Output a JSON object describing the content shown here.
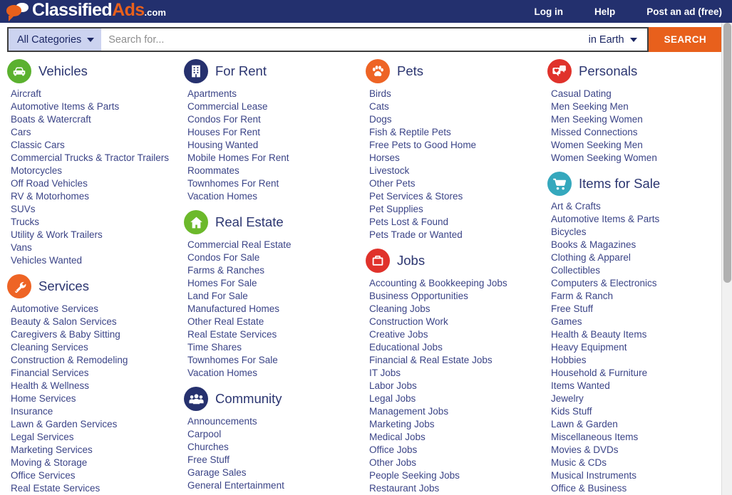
{
  "header": {
    "logo": {
      "part1": "Classified",
      "part2": "Ads",
      "part3": ".com",
      "icon": "speech-bubbles-icon"
    },
    "nav": [
      {
        "label": "Log in",
        "name": "login-link"
      },
      {
        "label": "Help",
        "name": "help-link"
      },
      {
        "label": "Post an ad (free)",
        "name": "post-ad-link"
      }
    ]
  },
  "search": {
    "category_selected": "All Categories",
    "placeholder": "Search for...",
    "value": "",
    "location_selected": "in Earth",
    "button_label": "SEARCH",
    "caret_icon": "chevron-down-icon"
  },
  "colors": {
    "navy": "#23306e",
    "orange": "#e8601c",
    "link": "#3b4487",
    "title": "#2b3570",
    "green": "#5bb12f",
    "darkblue": "#26316e",
    "red": "#e0322b",
    "teal": "#35a8bd",
    "category_chip": "#ccd3f0"
  },
  "columns": [
    {
      "groups": [
        {
          "title": "Vehicles",
          "icon": "car-icon",
          "color": "#5bb12f",
          "links": [
            "Aircraft",
            "Automotive Items & Parts",
            "Boats & Watercraft",
            "Cars",
            "Classic Cars",
            "Commercial Trucks & Tractor Trailers",
            "Motorcycles",
            "Off Road Vehicles",
            "RV & Motorhomes",
            "SUVs",
            "Trucks",
            "Utility & Work Trailers",
            "Vans",
            "Vehicles Wanted"
          ]
        },
        {
          "title": "Services",
          "icon": "wrench-icon",
          "color": "#ee6425",
          "links": [
            "Automotive Services",
            "Beauty & Salon Services",
            "Caregivers & Baby Sitting",
            "Cleaning Services",
            "Construction & Remodeling",
            "Financial Services",
            "Health & Wellness",
            "Home Services",
            "Insurance",
            "Lawn & Garden Services",
            "Legal Services",
            "Marketing Services",
            "Moving & Storage",
            "Office Services",
            "Real Estate Services"
          ]
        }
      ]
    },
    {
      "groups": [
        {
          "title": "For Rent",
          "icon": "apartment-building-icon",
          "color": "#26316e",
          "links": [
            "Apartments",
            "Commercial Lease",
            "Condos For Rent",
            "Houses For Rent",
            "Housing Wanted",
            "Mobile Homes For Rent",
            "Roommates",
            "Townhomes For Rent",
            "Vacation Homes"
          ]
        },
        {
          "title": "Real Estate",
          "icon": "house-icon",
          "color": "#6cb92b",
          "links": [
            "Commercial Real Estate",
            "Condos For Sale",
            "Farms & Ranches",
            "Homes For Sale",
            "Land For Sale",
            "Manufactured Homes",
            "Other Real Estate",
            "Real Estate Services",
            "Time Shares",
            "Townhomes For Sale",
            "Vacation Homes"
          ]
        },
        {
          "title": "Community",
          "icon": "people-group-icon",
          "color": "#26316e",
          "links": [
            "Announcements",
            "Carpool",
            "Churches",
            "Free Stuff",
            "Garage Sales",
            "General Entertainment"
          ]
        }
      ]
    },
    {
      "groups": [
        {
          "title": "Pets",
          "icon": "paw-print-icon",
          "color": "#ee6425",
          "links": [
            "Birds",
            "Cats",
            "Dogs",
            "Fish & Reptile Pets",
            "Free Pets to Good Home",
            "Horses",
            "Livestock",
            "Other Pets",
            "Pet Services & Stores",
            "Pet Supplies",
            "Pets Lost & Found",
            "Pets Trade or Wanted"
          ]
        },
        {
          "title": "Jobs",
          "icon": "briefcase-icon",
          "color": "#e0322b",
          "links": [
            "Accounting & Bookkeeping Jobs",
            "Business Opportunities",
            "Cleaning Jobs",
            "Construction Work",
            "Creative Jobs",
            "Educational Jobs",
            "Financial & Real Estate Jobs",
            "IT Jobs",
            "Labor Jobs",
            "Legal Jobs",
            "Management Jobs",
            "Marketing Jobs",
            "Medical Jobs",
            "Office Jobs",
            "Other Jobs",
            "People Seeking Jobs",
            "Restaurant Jobs"
          ]
        }
      ]
    },
    {
      "groups": [
        {
          "title": "Personals",
          "icon": "heart-chat-icon",
          "color": "#e0322b",
          "links": [
            "Casual Dating",
            "Men Seeking Men",
            "Men Seeking Women",
            "Missed Connections",
            "Women Seeking Men",
            "Women Seeking Women"
          ]
        },
        {
          "title": "Items for Sale",
          "icon": "shopping-cart-icon",
          "color": "#35a8bd",
          "links": [
            "Art & Crafts",
            "Automotive Items & Parts",
            "Bicycles",
            "Books & Magazines",
            "Clothing & Apparel",
            "Collectibles",
            "Computers & Electronics",
            "Farm & Ranch",
            "Free Stuff",
            "Games",
            "Health & Beauty Items",
            "Heavy Equipment",
            "Hobbies",
            "Household & Furniture",
            "Items Wanted",
            "Jewelry",
            "Kids Stuff",
            "Lawn & Garden",
            "Miscellaneous Items",
            "Movies & DVDs",
            "Music & CDs",
            "Musical Instruments",
            "Office & Business"
          ]
        }
      ]
    }
  ]
}
